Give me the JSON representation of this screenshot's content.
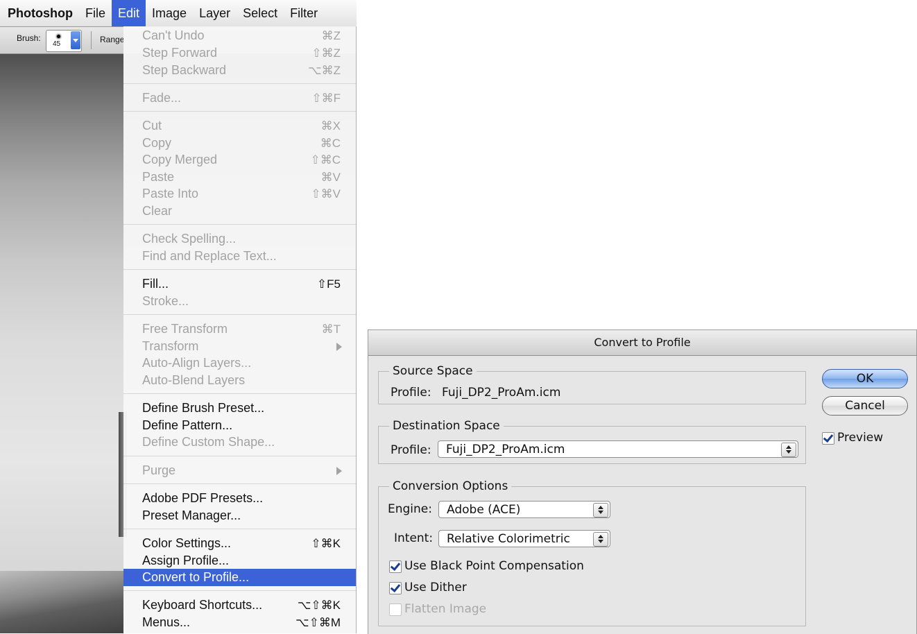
{
  "menubar": {
    "app": "Photoshop",
    "items": [
      "File",
      "Edit",
      "Image",
      "Layer",
      "Select",
      "Filter"
    ],
    "active": "Edit"
  },
  "options_bar": {
    "brush_label": "Brush:",
    "brush_size": "45",
    "range_label": "Range"
  },
  "edit_menu": {
    "items": [
      {
        "label": "Can't Undo",
        "shortcut": "⌘Z",
        "disabled": true
      },
      {
        "label": "Step Forward",
        "shortcut": "⇧⌘Z",
        "disabled": true
      },
      {
        "label": "Step Backward",
        "shortcut": "⌥⌘Z",
        "disabled": true
      },
      {
        "label": "Fade...",
        "shortcut": "⇧⌘F",
        "disabled": true
      },
      {
        "label": "Cut",
        "shortcut": "⌘X",
        "disabled": true
      },
      {
        "label": "Copy",
        "shortcut": "⌘C",
        "disabled": true
      },
      {
        "label": "Copy Merged",
        "shortcut": "⇧⌘C",
        "disabled": true
      },
      {
        "label": "Paste",
        "shortcut": "⌘V",
        "disabled": true
      },
      {
        "label": "Paste Into",
        "shortcut": "⇧⌘V",
        "disabled": true
      },
      {
        "label": "Clear",
        "shortcut": "",
        "disabled": true
      },
      {
        "label": "Check Spelling...",
        "shortcut": "",
        "disabled": true
      },
      {
        "label": "Find and Replace Text...",
        "shortcut": "",
        "disabled": true
      },
      {
        "label": "Fill...",
        "shortcut": "⇧F5",
        "disabled": false
      },
      {
        "label": "Stroke...",
        "shortcut": "",
        "disabled": true
      },
      {
        "label": "Free Transform",
        "shortcut": "⌘T",
        "disabled": true
      },
      {
        "label": "Transform",
        "shortcut": "",
        "disabled": true,
        "submenu": true
      },
      {
        "label": "Auto-Align Layers...",
        "shortcut": "",
        "disabled": true
      },
      {
        "label": "Auto-Blend Layers",
        "shortcut": "",
        "disabled": true
      },
      {
        "label": "Define Brush Preset...",
        "shortcut": "",
        "disabled": false
      },
      {
        "label": "Define Pattern...",
        "shortcut": "",
        "disabled": false
      },
      {
        "label": "Define Custom Shape...",
        "shortcut": "",
        "disabled": true
      },
      {
        "label": "Purge",
        "shortcut": "",
        "disabled": true,
        "submenu": true
      },
      {
        "label": "Adobe PDF Presets...",
        "shortcut": "",
        "disabled": false
      },
      {
        "label": "Preset Manager...",
        "shortcut": "",
        "disabled": false
      },
      {
        "label": "Color Settings...",
        "shortcut": "⇧⌘K",
        "disabled": false
      },
      {
        "label": "Assign Profile...",
        "shortcut": "",
        "disabled": false
      },
      {
        "label": "Convert to Profile...",
        "shortcut": "",
        "disabled": false,
        "highlighted": true
      },
      {
        "label": "Keyboard Shortcuts...",
        "shortcut": "⌥⇧⌘K",
        "disabled": false
      },
      {
        "label": "Menus...",
        "shortcut": "⌥⇧⌘M",
        "disabled": false
      }
    ]
  },
  "dialog": {
    "title": "Convert to Profile",
    "source": {
      "group_title": "Source Space",
      "profile_label": "Profile:",
      "profile_value": "Fuji_DP2_ProAm.icm"
    },
    "destination": {
      "group_title": "Destination Space",
      "profile_label": "Profile:",
      "profile_value": "Fuji_DP2_ProAm.icm"
    },
    "conversion": {
      "group_title": "Conversion Options",
      "engine_label": "Engine:",
      "engine_value": "Adobe (ACE)",
      "intent_label": "Intent:",
      "intent_value": "Relative Colorimetric",
      "black_point_label": "Use Black Point Compensation",
      "black_point_checked": true,
      "dither_label": "Use Dither",
      "dither_checked": true,
      "flatten_label": "Flatten Image",
      "flatten_checked": false,
      "flatten_disabled": true
    },
    "ok_label": "OK",
    "cancel_label": "Cancel",
    "preview_label": "Preview",
    "preview_checked": true
  },
  "colors": {
    "highlight": "#3b62d6",
    "disabled_text": "#a3a3a3",
    "checkmark": "#1c3d8f"
  }
}
